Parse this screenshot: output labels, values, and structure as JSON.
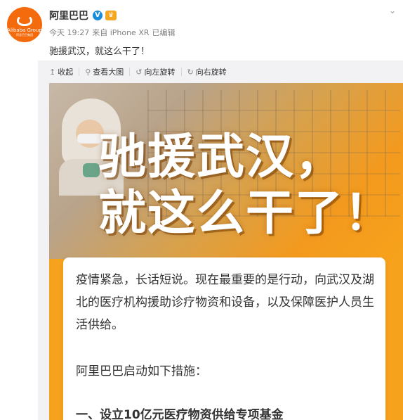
{
  "account": {
    "logo_text": "Alibaba Group",
    "logo_sub": "阿里巴巴集团",
    "name": "阿里巴巴",
    "verified_glyph": "V",
    "crown_glyph": "♛"
  },
  "post": {
    "time": "今天 19:27",
    "source": "来自 iPhone XR",
    "edited": "已编辑",
    "text": "驰援武汉，就这么干了！",
    "menu_icon": "chevron-down-icon"
  },
  "toolbar": {
    "collapse_icon": "↥",
    "collapse_label": "收起",
    "view_icon": "⚲",
    "view_label": "查看大图",
    "rotate_left_icon": "↺",
    "rotate_left_label": "向左旋转",
    "rotate_right_icon": "↻",
    "rotate_right_label": "向右旋转"
  },
  "poster": {
    "headline_line1": "驰援武汉，",
    "headline_line2": "就这么干了！",
    "para1": "疫情紧急，长话短说。现在最重要的是行动，向武汉及湖北的医疗机构援助诊疗物资和设备，以及保障医护人员生活供给。",
    "para2": "阿里巴巴启动如下措施：",
    "para3": "一、设立10亿元医疗物资供给专项基金",
    "accent_color": "#f7a21c"
  }
}
